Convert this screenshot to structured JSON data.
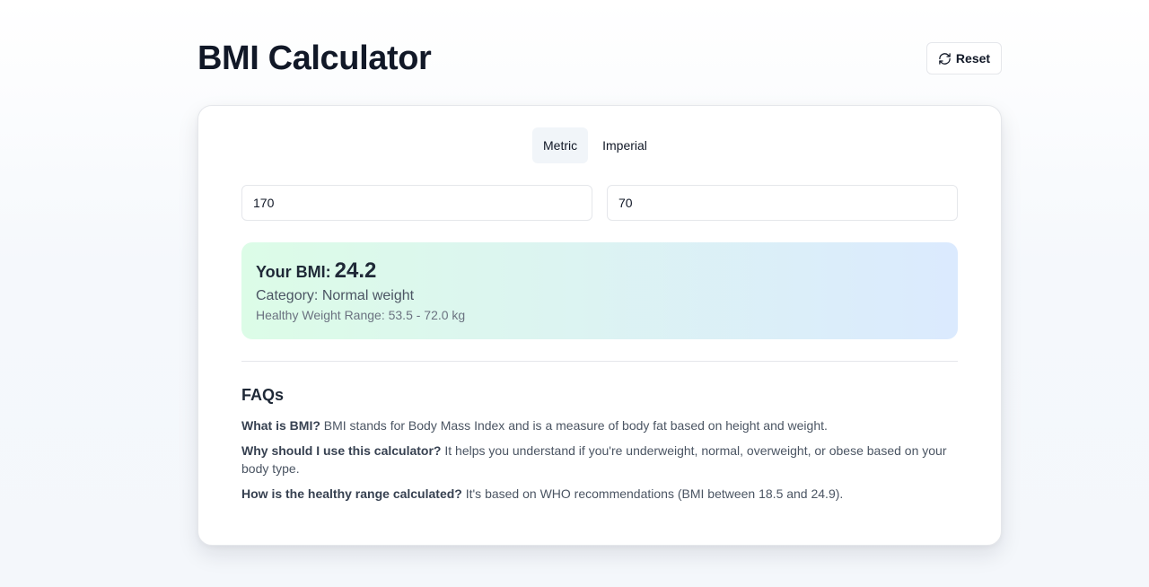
{
  "header": {
    "title": "BMI Calculator",
    "reset_label": "Reset",
    "reset_icon": "refresh-icon"
  },
  "tabs": [
    {
      "label": "Metric",
      "active": true
    },
    {
      "label": "Imperial",
      "active": false
    }
  ],
  "inputs": {
    "height_value": "170",
    "weight_value": "70"
  },
  "result": {
    "bmi_label": "Your BMI:",
    "bmi_value": "24.2",
    "category_text": "Category: Normal weight",
    "range_text": "Healthy Weight Range: 53.5 - 72.0 kg"
  },
  "faq": {
    "title": "FAQs",
    "items": [
      {
        "q": "What is BMI?",
        "a": " BMI stands for Body Mass Index and is a measure of body fat based on height and weight."
      },
      {
        "q": "Why should I use this calculator?",
        "a": " It helps you understand if you're underweight, normal, overweight, or obese based on your body type."
      },
      {
        "q": "How is the healthy range calculated?",
        "a": " It's based on WHO recommendations (BMI between 18.5 and 24.9)."
      }
    ]
  },
  "colors": {
    "result_gradient_start": "#dcfce7",
    "result_gradient_end": "#dbeafe",
    "active_tab_bg": "#f1f5f9",
    "text_primary": "#111827"
  }
}
